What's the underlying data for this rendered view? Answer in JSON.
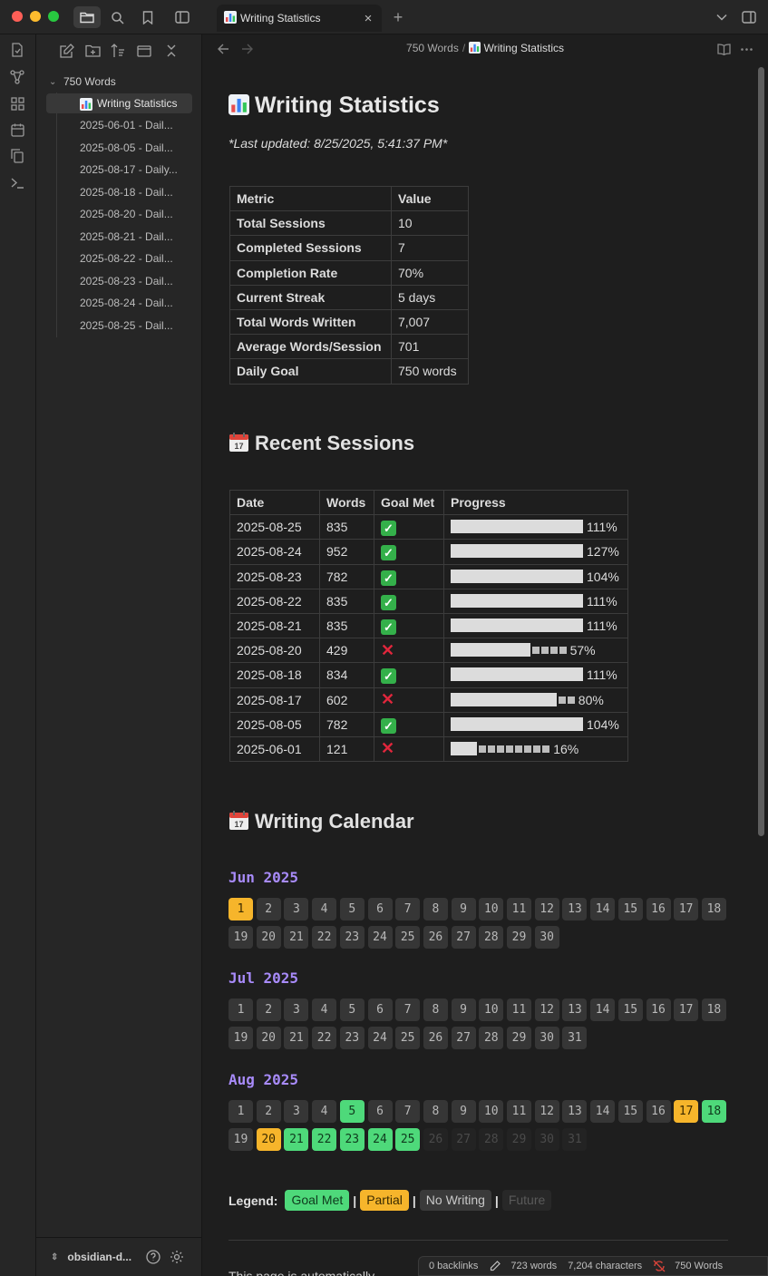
{
  "window": {
    "tab_title": "Writing Statistics"
  },
  "sidebar": {
    "folder_name": "750 Words",
    "files": [
      "Writing Statistics",
      "2025-06-01 - Dail...",
      "2025-08-05 - Dail...",
      "2025-08-17 - Daily...",
      "2025-08-18 - Dail...",
      "2025-08-20 - Dail...",
      "2025-08-21 - Dail...",
      "2025-08-22 - Dail...",
      "2025-08-23 - Dail...",
      "2025-08-24 - Dail...",
      "2025-08-25 - Dail..."
    ],
    "vault_name": "obsidian-d..."
  },
  "breadcrumb": {
    "parent": "750 Words",
    "current": "Writing Statistics"
  },
  "doc": {
    "title": "Writing Statistics",
    "last_updated": "*Last updated: 8/25/2025, 5:41:37 PM*",
    "metrics_headers": [
      "Metric",
      "Value"
    ],
    "metrics": [
      [
        "Total Sessions",
        "10"
      ],
      [
        "Completed Sessions",
        "7"
      ],
      [
        "Completion Rate",
        "70%"
      ],
      [
        "Current Streak",
        "5 days"
      ],
      [
        "Total Words Written",
        "7,007"
      ],
      [
        "Average Words/Session",
        "701"
      ],
      [
        "Daily Goal",
        "750 words"
      ]
    ],
    "recent_heading": "Recent Sessions",
    "sessions_headers": [
      "Date",
      "Words",
      "Goal Met",
      "Progress"
    ],
    "sessions": [
      {
        "date": "2025-08-25",
        "words": "835",
        "goal_met": true,
        "progress": 1.11,
        "pct": "111%"
      },
      {
        "date": "2025-08-24",
        "words": "952",
        "goal_met": true,
        "progress": 1.27,
        "pct": "127%"
      },
      {
        "date": "2025-08-23",
        "words": "782",
        "goal_met": true,
        "progress": 1.04,
        "pct": "104%"
      },
      {
        "date": "2025-08-22",
        "words": "835",
        "goal_met": true,
        "progress": 1.11,
        "pct": "111%"
      },
      {
        "date": "2025-08-21",
        "words": "835",
        "goal_met": true,
        "progress": 1.11,
        "pct": "111%"
      },
      {
        "date": "2025-08-20",
        "words": "429",
        "goal_met": false,
        "progress": 0.57,
        "pct": "57%"
      },
      {
        "date": "2025-08-18",
        "words": "834",
        "goal_met": true,
        "progress": 1.11,
        "pct": "111%"
      },
      {
        "date": "2025-08-17",
        "words": "602",
        "goal_met": false,
        "progress": 0.8,
        "pct": "80%"
      },
      {
        "date": "2025-08-05",
        "words": "782",
        "goal_met": true,
        "progress": 1.04,
        "pct": "104%"
      },
      {
        "date": "2025-06-01",
        "words": "121",
        "goal_met": false,
        "progress": 0.16,
        "pct": "16%"
      }
    ],
    "calendar_heading": "Writing Calendar",
    "calendar": [
      {
        "month": "Jun 2025",
        "days": 30,
        "partial": [
          1
        ],
        "goal": [],
        "future_from": null
      },
      {
        "month": "Jul 2025",
        "days": 31,
        "partial": [],
        "goal": [],
        "future_from": null
      },
      {
        "month": "Aug 2025",
        "days": 31,
        "partial": [
          17,
          20
        ],
        "goal": [
          5,
          18,
          21,
          22,
          23,
          24,
          25
        ],
        "future_from": 26
      }
    ],
    "legend": {
      "title": "Legend:",
      "goal": "Goal Met",
      "partial": "Partial",
      "none": "No Writing",
      "future": "Future",
      "separator": "|"
    },
    "trailing_text": "This page is automatically..."
  },
  "status": {
    "backlinks": "0 backlinks",
    "words": "723 words",
    "characters": "7,204 characters",
    "plugin": "750 Words"
  },
  "colors": {
    "goal": "#4ed97a",
    "partial": "#f6b52b",
    "month": "#a88bfa",
    "bg": "#1e1e1e"
  }
}
